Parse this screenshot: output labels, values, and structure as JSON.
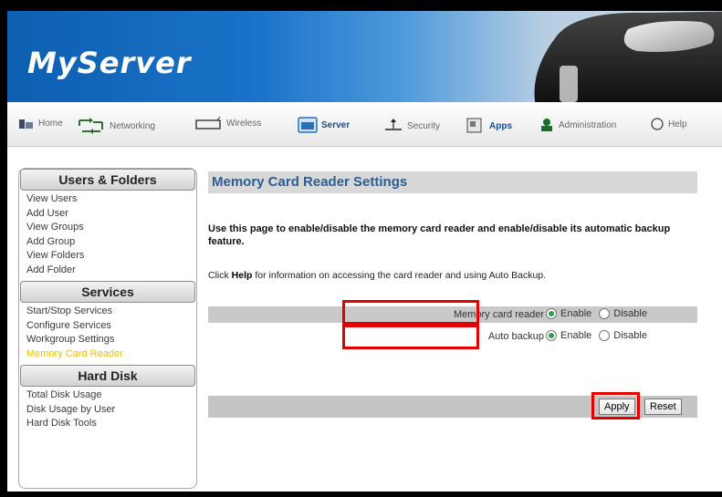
{
  "app": {
    "logo_text": "MyServer"
  },
  "nav": {
    "items": [
      {
        "label": "Home",
        "icon": "home-icon"
      },
      {
        "label": "Networking",
        "icon": "network-icon"
      },
      {
        "label": "Wireless",
        "icon": "wireless-icon"
      },
      {
        "label": "Server",
        "icon": "server-icon",
        "active": true
      },
      {
        "label": "Security",
        "icon": "security-icon"
      },
      {
        "label": "Apps",
        "icon": "apps-icon"
      },
      {
        "label": "Administration",
        "icon": "administration-icon"
      },
      {
        "label": "Help",
        "icon": "help-icon"
      }
    ]
  },
  "sidebar": {
    "sections": [
      {
        "title": "Users & Folders",
        "links": [
          "View Users",
          "Add User",
          "View Groups",
          "Add Group",
          "View Folders",
          "Add Folder"
        ]
      },
      {
        "title": "Services",
        "links": [
          "Start/Stop Services",
          "Configure Services",
          "Workgroup Settings",
          "Memory Card Reader"
        ]
      },
      {
        "title": "Hard Disk",
        "links": [
          "Total Disk Usage",
          "Disk Usage by User",
          "Hard Disk Tools"
        ]
      }
    ],
    "current_link": "Memory Card Reader"
  },
  "main": {
    "title": "Memory Card Reader Settings",
    "intro": "Use this page to enable/disable the memory card reader and enable/disable its automatic backup feature.",
    "help_prefix": "Click ",
    "help_bold": "Help",
    "help_suffix": " for information on accessing the card reader and using Auto Backup.",
    "settings": [
      {
        "label": "Memory card reader",
        "selected": "Enable",
        "options": [
          "Enable",
          "Disable"
        ]
      },
      {
        "label": "Auto backup",
        "selected": "Enable",
        "options": [
          "Enable",
          "Disable"
        ]
      }
    ],
    "apply_label": "Apply",
    "reset_label": "Reset"
  },
  "colors": {
    "highlight": "#e40000",
    "title_text": "#2b5e93",
    "current_link": "#f2c200",
    "radio_selected": "#2fa04a"
  }
}
